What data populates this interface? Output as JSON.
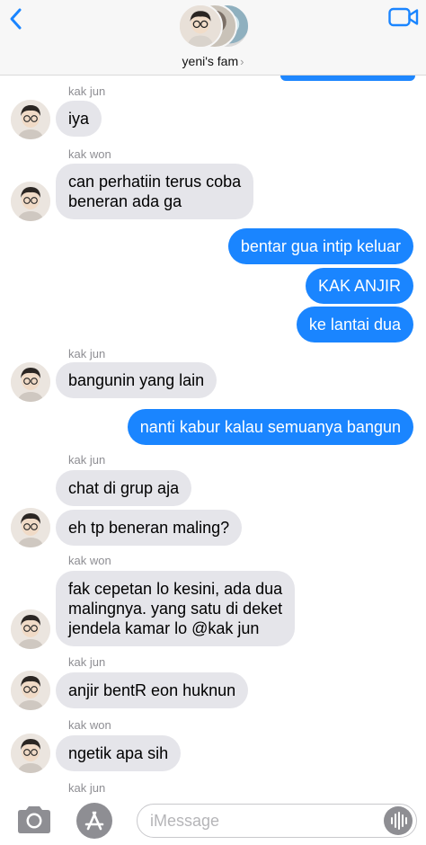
{
  "header": {
    "back_icon": "chevron-left-icon",
    "video_icon": "video-camera-icon",
    "group_name": "yeni's fam",
    "chevron": "›",
    "accent_color": "#1a85ff"
  },
  "messages": [
    {
      "sender": "kak jun"
    },
    {
      "text": "iya",
      "direction": "incoming"
    },
    {
      "sender": "kak won"
    },
    {
      "text_lines": [
        "can perhatiin terus coba",
        "beneran ada ga"
      ],
      "direction": "incoming"
    },
    {
      "text": "bentar gua intip keluar",
      "direction": "outgoing"
    },
    {
      "text": "KAK ANJIR",
      "direction": "outgoing"
    },
    {
      "text": "ke lantai dua",
      "direction": "outgoing"
    },
    {
      "sender": "kak jun"
    },
    {
      "text": "bangunin yang lain",
      "direction": "incoming"
    },
    {
      "text": "nanti kabur kalau semuanya bangun",
      "direction": "outgoing"
    },
    {
      "sender": "kak jun"
    },
    {
      "text": "chat di grup aja",
      "direction": "incoming"
    },
    {
      "text": "eh tp beneran maling?",
      "direction": "incoming"
    },
    {
      "sender": "kak won"
    },
    {
      "text_lines": [
        "fak cepetan lo kesini, ada dua",
        "malingnya. yang satu di deket",
        "jendela kamar lo @kak jun"
      ],
      "direction": "incoming"
    },
    {
      "sender": "kak jun"
    },
    {
      "text": "anjir bentR eon huknun",
      "direction": "incoming"
    },
    {
      "sender": "kak won"
    },
    {
      "text": "ngetik apa sih",
      "direction": "incoming"
    },
    {
      "sender": "kak jun"
    }
  ],
  "input_bar": {
    "camera_icon": "camera-icon",
    "appstore_icon": "app-store-icon",
    "placeholder": "iMessage",
    "audio_icon": "audio-waveform-icon"
  },
  "colors": {
    "incoming_bubble": "#e5e5ea",
    "outgoing_bubble": "#1a85ff",
    "header_bg": "#f7f7f7"
  }
}
